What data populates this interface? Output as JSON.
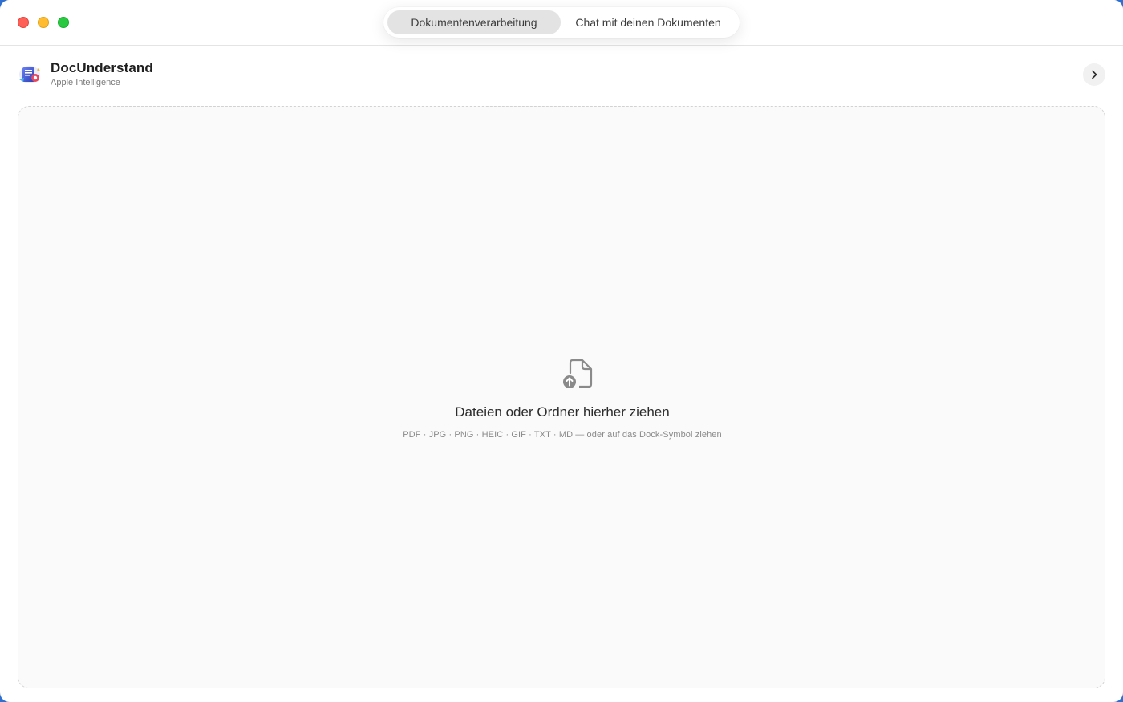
{
  "window": {
    "controls": {
      "close": "close-button",
      "minimize": "minimize-button",
      "zoom": "zoom-button"
    }
  },
  "tabs": [
    {
      "label": "Dokumentenverarbeitung",
      "active": true
    },
    {
      "label": "Chat mit deinen Dokumenten",
      "active": false
    }
  ],
  "header": {
    "app_name": "DocUnderstand",
    "app_subtitle": "Apple Intelligence",
    "chevron_icon": "chevron-right-icon"
  },
  "dropzone": {
    "icon": "document-upload-icon",
    "title": "Dateien oder Ordner hierher ziehen",
    "subtitle": "PDF · JPG · PNG · HEIC · GIF · TXT · MD — oder auf das Dock-Symbol ziehen"
  },
  "colors": {
    "close": "#fe5f57",
    "minimize": "#febc2e",
    "zoom": "#28c840",
    "active_tab_bg": "#e3e3e3",
    "dropzone_border": "#d2d2d2"
  }
}
